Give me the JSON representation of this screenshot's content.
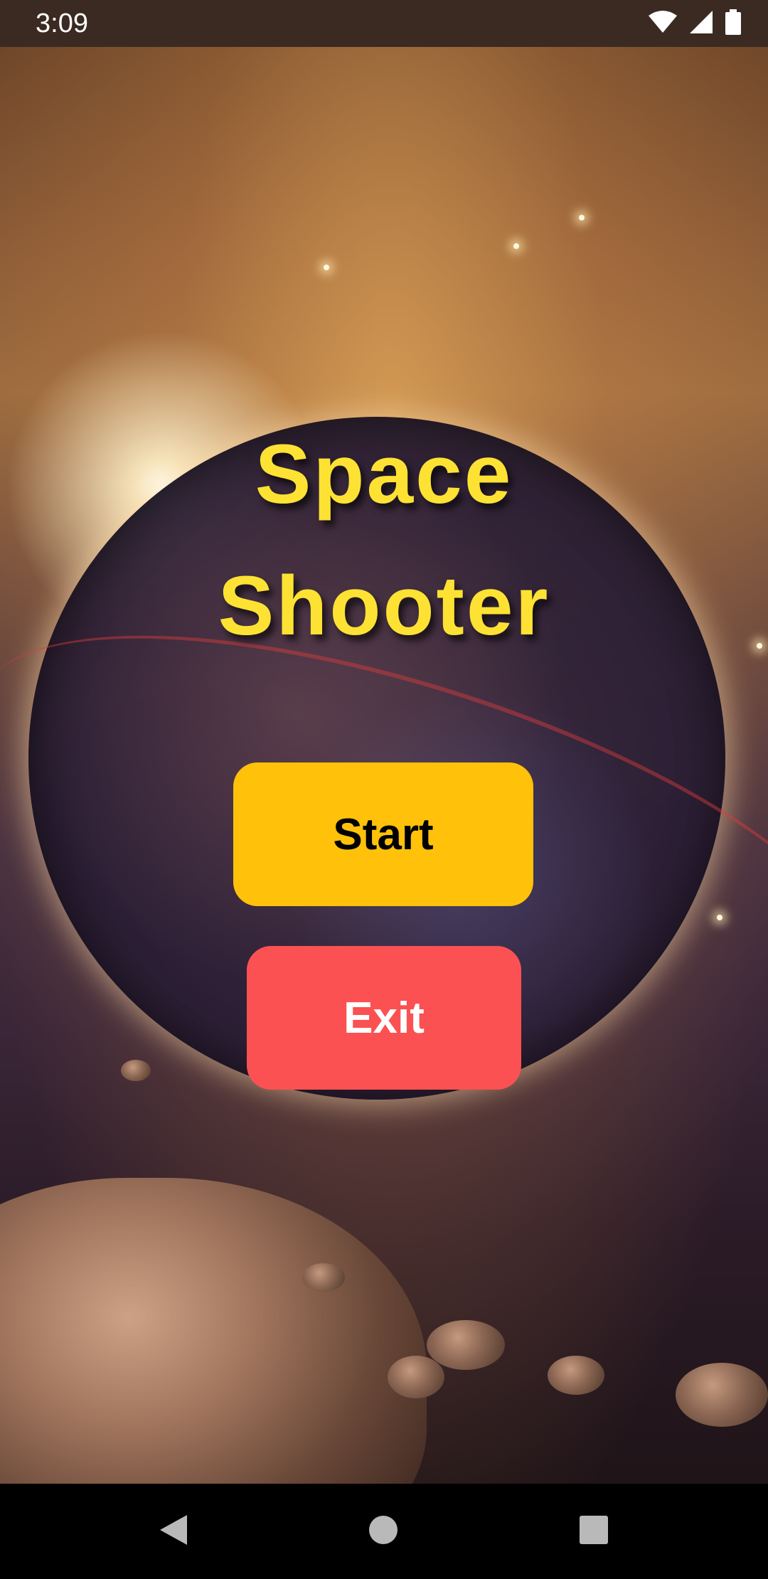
{
  "status_bar": {
    "time": "3:09",
    "icons": [
      "wifi-icon",
      "signal-icon",
      "battery-icon"
    ]
  },
  "app": {
    "title_line1": "Space",
    "title_line2": "Shooter",
    "start_label": "Start",
    "exit_label": "Exit"
  },
  "colors": {
    "title": "#fde234",
    "start_button": "#ffc10a",
    "exit_button": "#fb5152"
  },
  "nav_bar": {
    "buttons": [
      "back-icon",
      "home-icon",
      "recents-icon"
    ]
  }
}
